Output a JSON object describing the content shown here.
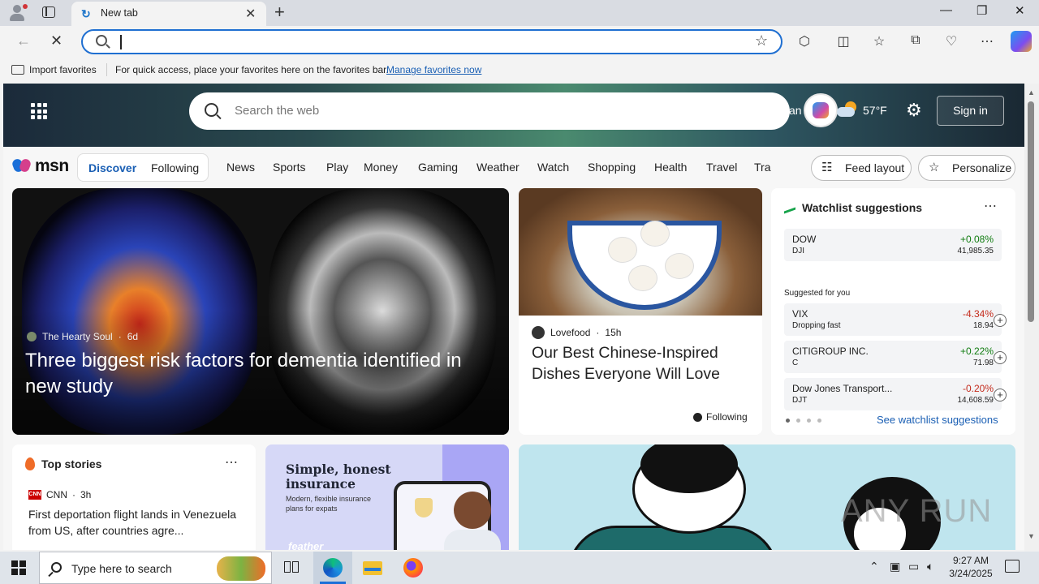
{
  "browser": {
    "tab_title": "New tab",
    "new_tab_glyph": "+",
    "address_value": "",
    "favorites_bar": {
      "import_label": "Import favorites",
      "message": "For quick access, place your favorites here on the favorites bar.",
      "manage_link": "Manage favorites now"
    }
  },
  "msn": {
    "search_placeholder": "Search the web",
    "header_fragment": "an",
    "weather_temp": "57°F",
    "signin_label": "Sign in",
    "logo_text": "msn",
    "segment": {
      "discover": "Discover",
      "following": "Following"
    },
    "categories": [
      "News",
      "Sports",
      "Play",
      "Money",
      "Gaming",
      "Weather",
      "Watch",
      "Shopping",
      "Health",
      "Travel",
      "Tra"
    ],
    "feed_layout_label": "Feed layout",
    "personalize_label": "Personalize"
  },
  "cards": {
    "hero": {
      "source": "The Hearty Soul",
      "age": "6d",
      "headline": "Three biggest risk factors for dementia identified in new study"
    },
    "food": {
      "source": "Lovefood",
      "age": "15h",
      "headline": "Our Best Chinese-Inspired Dishes Everyone Will Love",
      "following_label": "Following"
    },
    "watchlist": {
      "title": "Watchlist suggestions",
      "suggested_label": "Suggested for you",
      "see_all": "See watchlist suggestions",
      "items": [
        {
          "name": "DOW",
          "sub": "DJI",
          "change": "+0.08%",
          "value": "41,985.35",
          "dir": "up"
        },
        {
          "name": "VIX",
          "sub": "Dropping fast",
          "change": "-4.34%",
          "value": "18.94",
          "dir": "down"
        },
        {
          "name": "CITIGROUP INC.",
          "sub": "C",
          "change": "+0.22%",
          "value": "71.98",
          "dir": "up"
        },
        {
          "name": "Dow Jones Transport...",
          "sub": "DJT",
          "change": "-0.20%",
          "value": "14,608.59",
          "dir": "down"
        }
      ]
    },
    "top_stories": {
      "title": "Top stories",
      "source": "CNN",
      "age": "3h",
      "headline": "First deportation flight lands in Venezuela from US, after countries agre..."
    },
    "ad": {
      "title": "Simple, honest insurance",
      "body": "Modern, flexible insurance plans for expats",
      "brand": "feather"
    }
  },
  "watermark": "ANY RUN",
  "taskbar": {
    "search_placeholder": "Type here to search",
    "time": "9:27 AM",
    "date": "3/24/2025"
  },
  "colors": {
    "accent": "#1f6fd1",
    "up": "#107c10",
    "down": "#c42b1c"
  }
}
